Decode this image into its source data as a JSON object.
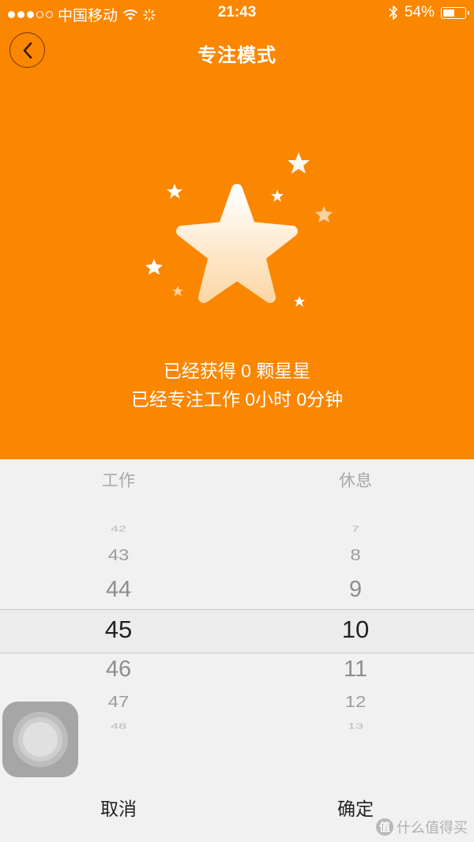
{
  "status_bar": {
    "carrier": "中国移动",
    "time": "21:43",
    "battery_percent": "54%"
  },
  "header": {
    "title": "专注模式"
  },
  "summary": {
    "stars_line": "已经获得 0 颗星星",
    "time_line": "已经专注工作 0小时 0分钟"
  },
  "picker": {
    "work_label": "工作",
    "rest_label": "休息",
    "work_values": [
      "42",
      "43",
      "44",
      "45",
      "46",
      "47",
      "48"
    ],
    "rest_values": [
      "7",
      "8",
      "9",
      "10",
      "11",
      "12",
      "13"
    ],
    "work_selected": "45",
    "rest_selected": "10"
  },
  "actions": {
    "cancel_label": "取消",
    "confirm_label": "确定"
  },
  "watermark": {
    "text": "什么值得买"
  },
  "colors": {
    "accent": "#fb8600",
    "picker_bg": "#f1f1f1"
  }
}
